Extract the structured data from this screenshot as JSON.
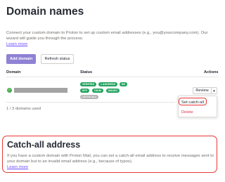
{
  "page": {
    "title": "Domain names"
  },
  "intro": {
    "text": "Connect your custom domain to Proton to set up custom email addresses (e.g., you@yourcompany.com). Our wizard will guide you through the process.",
    "learn_more": "Learn more"
  },
  "toolbar": {
    "add_domain": "Add domain",
    "refresh_status": "Refresh status"
  },
  "table": {
    "headers": {
      "domain": "Domain",
      "status": "Status",
      "actions": "Actions"
    },
    "row": {
      "badges": [
        {
          "label": "VERIFIED",
          "color": "#21a35e"
        },
        {
          "label": "1 ADDRESS",
          "color": "#21a35e"
        },
        {
          "label": "MX",
          "color": "#21a35e"
        },
        {
          "label": "SPF",
          "color": "#21a35e"
        },
        {
          "label": "DKIM",
          "color": "#21a35e"
        },
        {
          "label": "DMARC",
          "color": "#21a35e"
        },
        {
          "label": "CATCH-ALL",
          "color": "#b4b4b4"
        }
      ],
      "action_label": "Review"
    }
  },
  "dropdown": {
    "set_catch_all": "Set catch-all",
    "delete": "Delete"
  },
  "count": "1 / 3 domains used",
  "catch_all": {
    "title": "Catch-all address",
    "text": "If you have a custom domain with Proton Mail, you can set a catch-all email address to receive messages sent to your domain but to an invalid email address (e.g., because of typos).",
    "learn_more": "Learn more"
  },
  "colors": {
    "accent": "#6d4aff",
    "button_primary": "#8f82d4",
    "success": "#21a35e",
    "danger": "#dc3251",
    "highlight": "#e53935"
  }
}
